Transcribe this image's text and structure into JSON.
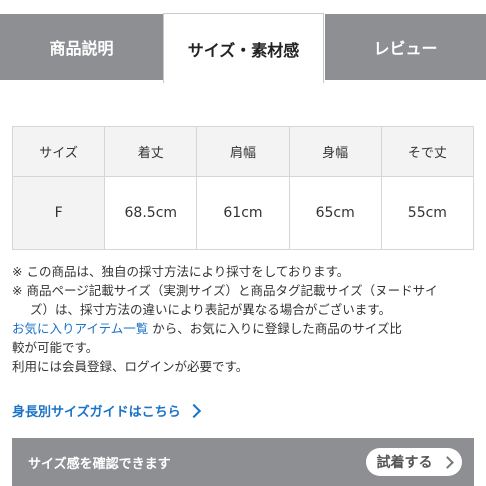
{
  "tabs": [
    {
      "label": "商品説明"
    },
    {
      "label": "サイズ・素材感"
    },
    {
      "label": "レビュー"
    }
  ],
  "size_table": {
    "headers": [
      "サイズ",
      "着丈",
      "肩幅",
      "身幅",
      "そで丈"
    ],
    "rows": [
      {
        "size": "F",
        "values": [
          "68.5cm",
          "61cm",
          "65cm",
          "55cm"
        ]
      }
    ]
  },
  "notes": {
    "note1": "※ この商品は、独自の採寸方法により採寸をしております。",
    "note2_line1": "※ 商品ページ記載サイズ（実測サイズ）と商品タグ記載サイズ（ヌードサイ",
    "note2_line2": "ズ）は、採寸方法の違いにより表記が異なる場合がございます。",
    "favorites_link": "お気に入りアイテム一覧",
    "favorites_text_a": " から、お気に入りに登録した商品のサイズ比",
    "favorites_text_b": "較が可能です。",
    "login_text": "利用には会員登録、ログインが必要です。"
  },
  "guide_link": "身長別サイズガイドはこちら",
  "bottom_bar": {
    "label": "サイズ感を確認できます",
    "button": "試着する"
  }
}
